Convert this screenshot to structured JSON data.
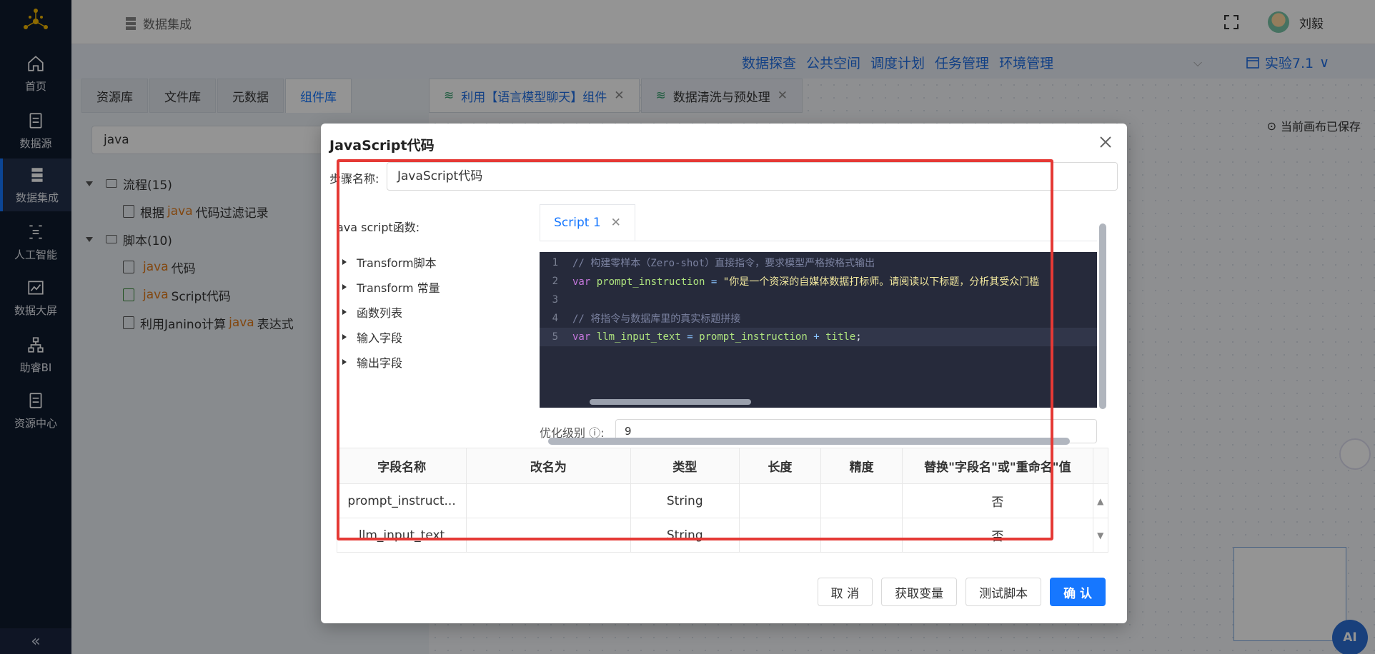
{
  "topbar": {
    "breadcrumb": "数据集成",
    "username": "刘毅"
  },
  "sidebar": {
    "items": [
      {
        "label": "首页",
        "icon": "home-icon"
      },
      {
        "label": "数据源",
        "icon": "database-icon"
      },
      {
        "label": "数据集成",
        "icon": "integration-icon"
      },
      {
        "label": "人工智能",
        "icon": "ai-icon"
      },
      {
        "label": "数据大屏",
        "icon": "dashboard-icon"
      },
      {
        "label": "助睿BI",
        "icon": "bi-icon"
      },
      {
        "label": "资源中心",
        "icon": "resource-icon"
      }
    ],
    "collapse": "«"
  },
  "linkbar": {
    "links": [
      "数据探查",
      "公共空间",
      "调度计划",
      "任务管理",
      "环境管理"
    ],
    "experiment": "实验7.1"
  },
  "leftpanel": {
    "tabs": [
      "资源库",
      "文件库",
      "元数据",
      "组件库"
    ],
    "search_value": "java",
    "tree": {
      "group1": "流程(15)",
      "item1_pre": "根据",
      "item1_kw": "java",
      "item1_post": "代码过滤记录",
      "group2": "脚本(10)",
      "item2_kw": "java",
      "item2_post": "代码",
      "item3_kw": "java",
      "item3_post": "Script代码",
      "item4_pre": "利用Janino计算",
      "item4_kw": "java",
      "item4_post": "表达式"
    }
  },
  "canvas": {
    "tabs": [
      "利用【语言模型聊天】组件",
      "数据清洗与预处理"
    ],
    "saved": "当前画布已保存",
    "ai": "AI"
  },
  "dialog": {
    "title": "JavaScript代码",
    "step_label": "步骤名称:",
    "step_value": "JavaScript代码",
    "fn_label": "ava script函数:",
    "fn_items": [
      "Transform脚本",
      "Transform 常量",
      "函数列表",
      "输入字段",
      "输出字段"
    ],
    "script_tab": "Script 1",
    "code": {
      "l1": "// 构建零样本（Zero-shot）直接指令，要求模型严格按格式输出",
      "l2_kw": "var",
      "l2_var": "prompt_instruction",
      "l2_eq": "=",
      "l2_str": "\"你是一个资深的自媒体数据打标师。请阅读以下标题，分析其受众门槛",
      "l4": "// 将指令与数据库里的真实标题拼接",
      "l5_kw": "var",
      "l5_var": "llm_input_text",
      "l5_eq": "=",
      "l5_a": "prompt_instruction",
      "l5_plus": "+",
      "l5_b": "title",
      "l5_end": ";"
    },
    "opt_label": "优化级别 ⓘ:",
    "opt_value": "9",
    "table": {
      "headers": [
        "字段名称",
        "改名为",
        "类型",
        "长度",
        "精度",
        "替换\"字段名\"或\"重命名\"值"
      ],
      "rows": [
        [
          "prompt_instruct...",
          "",
          "String",
          "",
          "",
          "否"
        ],
        [
          "llm_input_text",
          "",
          "String",
          "",
          "",
          "否"
        ]
      ]
    },
    "buttons": {
      "cancel": "取 消",
      "get_vars": "获取变量",
      "test": "测试脚本",
      "ok": "确 认"
    }
  }
}
